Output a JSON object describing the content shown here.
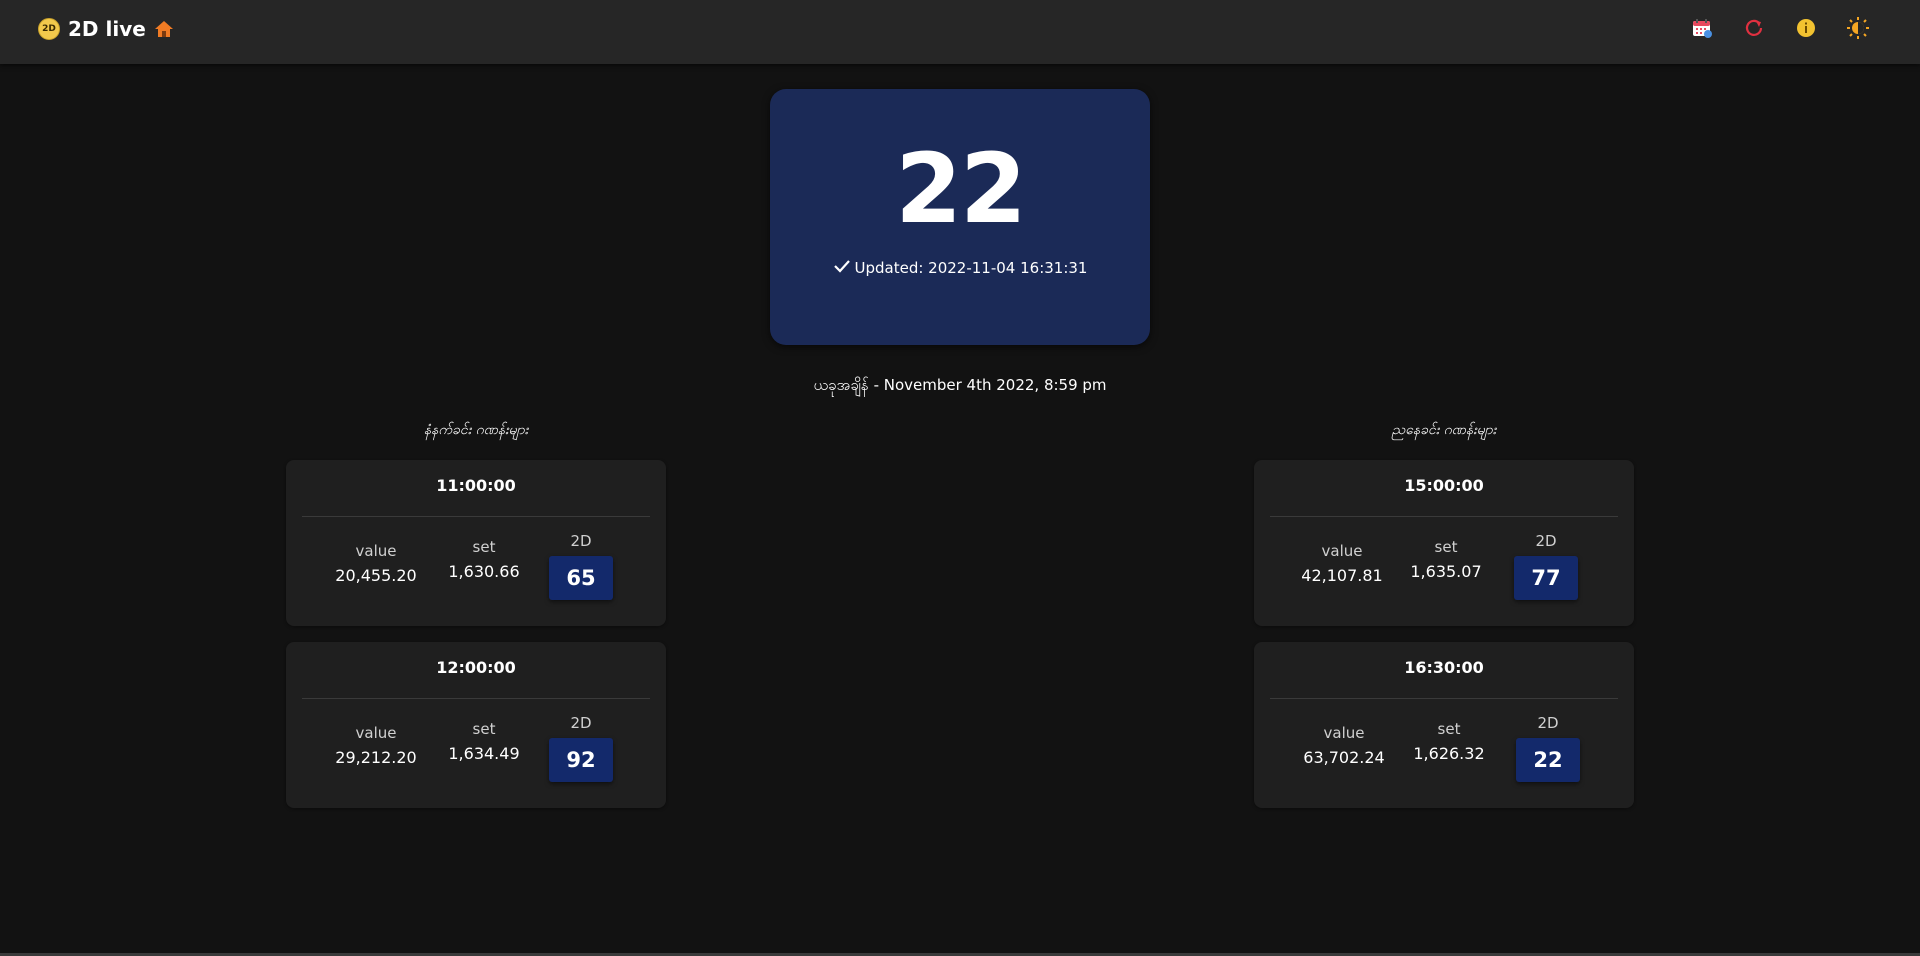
{
  "header": {
    "logo_text": "2D",
    "title": "2D live",
    "icons": {
      "home": "home-icon",
      "calendar": "calendar-icon",
      "refresh": "refresh-icon",
      "info": "info-icon",
      "theme": "theme-toggle-icon"
    }
  },
  "hero": {
    "number": "22",
    "updated": "Updated: 2022-11-04 16:31:31"
  },
  "current_time": "ယခုအချိန် - November 4th 2022, 8:59 pm",
  "morning": {
    "title": "နံနက်ခင်း ဂဏန်းများ",
    "cards": [
      {
        "time": "11:00:00",
        "value": "20,455.20",
        "set": "1,630.66",
        "twod": "65"
      },
      {
        "time": "12:00:00",
        "value": "29,212.20",
        "set": "1,634.49",
        "twod": "92"
      }
    ]
  },
  "evening": {
    "title": "ညနေခင်း ဂဏန်းများ",
    "cards": [
      {
        "time": "15:00:00",
        "value": "42,107.81",
        "set": "1,635.07",
        "twod": "77"
      },
      {
        "time": "16:30:00",
        "value": "63,702.24",
        "set": "1,626.32",
        "twod": "22"
      }
    ]
  },
  "labels": {
    "value": "value",
    "set": "set",
    "twod": "2D"
  },
  "colors": {
    "background": "#121212",
    "navbar": "#262626",
    "hero": "#1b2a57",
    "card": "#1f1f1f",
    "twod_box": "#13296b"
  }
}
